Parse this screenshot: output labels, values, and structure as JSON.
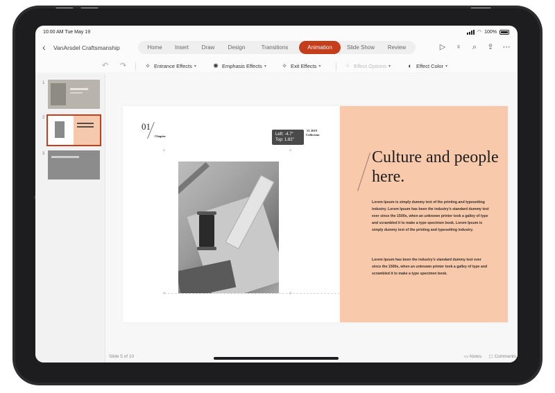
{
  "status": {
    "time": "10:00 AM  Tue May 19",
    "battery": "100%"
  },
  "header": {
    "doc_title": "VanArsdel Craftsmanship",
    "tabs": [
      {
        "label": "Home"
      },
      {
        "label": "Insert"
      },
      {
        "label": "Draw"
      },
      {
        "label": "Design"
      },
      {
        "label": "Transitions"
      },
      {
        "label": "Animation"
      },
      {
        "label": "Slide Show"
      },
      {
        "label": "Review"
      }
    ],
    "active_tab": "Animation",
    "accent_color": "#c43e1c",
    "icons": [
      "play-icon",
      "lightbulb-icon",
      "search-icon",
      "share-icon",
      "more-icon"
    ]
  },
  "ribbon": {
    "entrance": "Entrance Effects",
    "emphasis": "Emphasis Effects",
    "exit": "Exit Effects",
    "effect_options": "Effect Options",
    "effect_color": "Effect Color"
  },
  "thumbnails": [
    {
      "number": "1"
    },
    {
      "number": "2"
    },
    {
      "number": "3"
    }
  ],
  "slide": {
    "number": "01",
    "chapter": "Chapter",
    "tooltip_left": "Left: -4.7\"",
    "tooltip_top": "Top: 1.82\"",
    "collection_line1": "'21 2019",
    "collection_line2": "Collection",
    "headline": "Culture and people here.",
    "body1": "Lorem Ipsum is simply dummy text of the printing and typesetting industry. Lorem Ipsum has been the industry's standard dummy text ever since the 1500s, when an unknown printer took a galley of type and scrambled it to make a type specimen book. Lorem Ipsum is simply dummy text of the printing and typesetting industry.",
    "body2": "Lorem Ipsum has been the industry's standard dummy text ever since the 1500s, when an unknown printer took a galley of type and scrambled it to make a type specimen book.",
    "panel_color": "#f8c9aa"
  },
  "footer": {
    "slide_count": "Slide 5 of 10",
    "notes": "Notes",
    "comments": "Comments"
  }
}
